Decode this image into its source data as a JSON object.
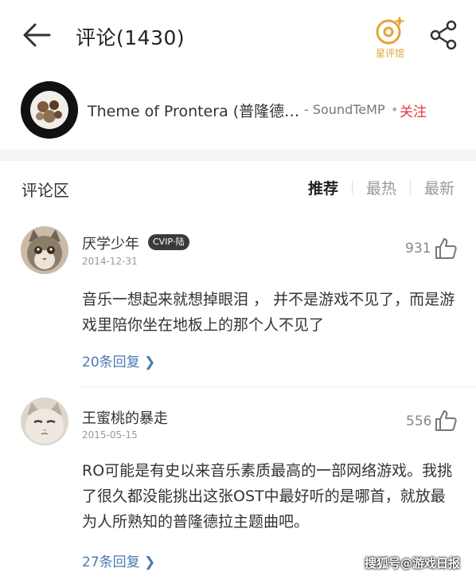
{
  "header": {
    "title": "评论(1430)",
    "star_label": "星评馆",
    "accent_color": "#e3a43a"
  },
  "song": {
    "title": "Theme of Prontera (普隆德…",
    "artist": "- SoundTeMP",
    "dot": "•",
    "follow_label": "关注",
    "follow_color": "#e2373b"
  },
  "section": {
    "title": "评论区",
    "tabs": [
      {
        "label": "推荐",
        "active": true
      },
      {
        "label": "最热",
        "active": false
      },
      {
        "label": "最新",
        "active": false
      }
    ]
  },
  "comments": [
    {
      "user": "厌学少年",
      "badge": "CVIP·陆",
      "date": "2014-12-31",
      "likes": "931",
      "text": "音乐一想起来就想掉眼泪 ， 并不是游戏不见了，而是游戏里陪你坐在地板上的那个人不见了",
      "replies": "20条回复 ❯"
    },
    {
      "user": "王蜜桃的暴走",
      "date": "2015-05-15",
      "likes": "556",
      "text": "RO可能是有史以来音乐素质最高的一部网络游戏。我挑了很久都没能挑出这张OST中最好听的是哪首，就放最为人所熟知的普隆德拉主题曲吧。",
      "replies": "27条回复 ❯"
    }
  ],
  "watermark": "搜狐号@游戏日报",
  "link_color": "#4a7ab3"
}
